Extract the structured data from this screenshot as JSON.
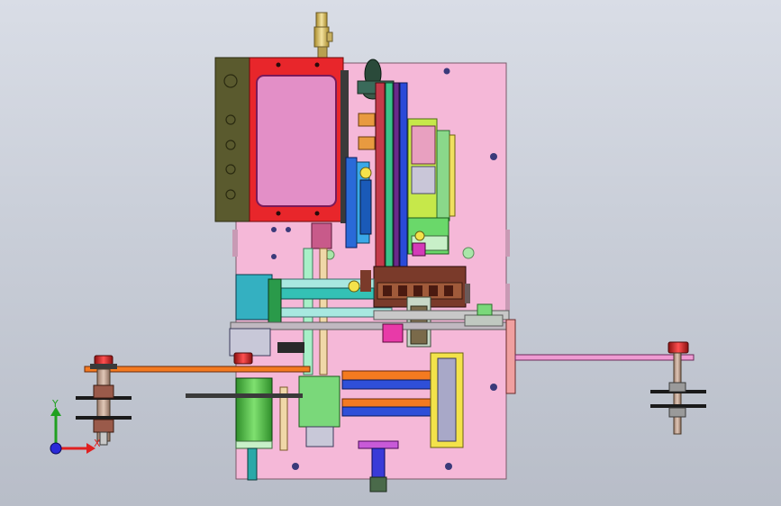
{
  "viewport": {
    "background_top": "#d9dde6",
    "background_bottom": "#b8bdc8",
    "model_colors": {
      "base_plate": "#f5b8d8",
      "housing": "#5a5a2e",
      "frame_red": "#e8262b",
      "window": "#e38fc7",
      "rail_green": "#5cb85c",
      "rail_teal": "#34c1b5",
      "block_brown": "#7a3a2a",
      "beam_orange": "#f47a20",
      "beam_blue": "#2f4fd8",
      "bracket_yellow": "#f3e24a",
      "motor_green": "#4fbf47",
      "arm_pink": "#ef9ad2",
      "lime": "#c6e84a"
    }
  },
  "triad": {
    "x_label": "X",
    "y_label": "Y",
    "x_icon": "x-axis-arrow",
    "y_icon": "y-axis-arrow",
    "origin_icon": "origin-sphere"
  }
}
